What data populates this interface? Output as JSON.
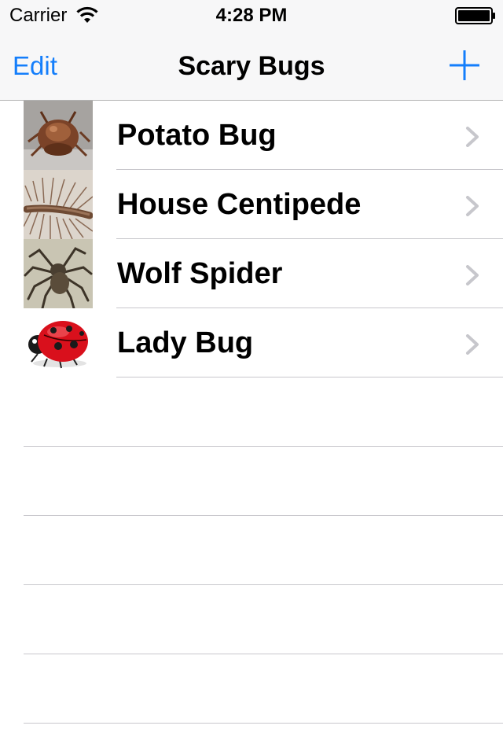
{
  "status_bar": {
    "carrier": "Carrier",
    "time": "4:28 PM",
    "wifi_icon": "wifi-icon",
    "battery_icon": "battery-icon"
  },
  "nav_bar": {
    "edit_label": "Edit",
    "title": "Scary Bugs",
    "add_icon": "plus-icon"
  },
  "colors": {
    "tint": "#147efb",
    "separator": "#c8c7cc",
    "nav_background": "#f7f7f8",
    "chevron": "#c7c7cc"
  },
  "bugs": [
    {
      "name": "Potato Bug",
      "thumbnail": "potato-bug-thumbnail"
    },
    {
      "name": "House Centipede",
      "thumbnail": "house-centipede-thumbnail"
    },
    {
      "name": "Wolf Spider",
      "thumbnail": "wolf-spider-thumbnail"
    },
    {
      "name": "Lady Bug",
      "thumbnail": "lady-bug-thumbnail"
    }
  ]
}
